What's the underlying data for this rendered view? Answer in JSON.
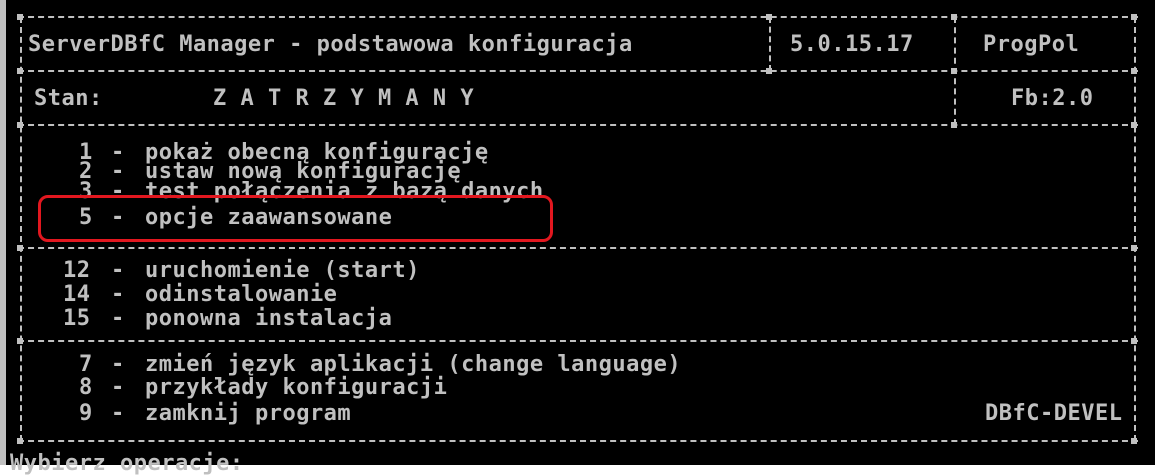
{
  "header": {
    "title": "ServerDBfC Manager - podstawowa konfiguracja",
    "version": "5.0.15.17",
    "vendor": "ProgPol"
  },
  "status": {
    "label": "Stan:",
    "value": "Z A T R Z Y M A N Y",
    "fb": "Fb:2.0"
  },
  "menu_group1": [
    {
      "number": "1",
      "label": "pokaż obecną konfigurację"
    },
    {
      "number": "2",
      "label": "ustaw nową konfigurację"
    },
    {
      "number": "3",
      "label": "test połączenia z bazą danych"
    },
    {
      "number": "5",
      "label": "opcje zaawansowane"
    }
  ],
  "menu_group2": [
    {
      "number": "12",
      "label": "uruchomienie (start)"
    },
    {
      "number": "14",
      "label": "odinstalowanie"
    },
    {
      "number": "15",
      "label": "ponowna instalacja"
    }
  ],
  "menu_group3": [
    {
      "number": "7",
      "label": "zmień język aplikacji (change language)"
    },
    {
      "number": "8",
      "label": "przykłady konfiguracji"
    },
    {
      "number": "9",
      "label": "zamknij program"
    }
  ],
  "footer_tag": "DBfC-DEVEL",
  "prompt": "Wybierz operacje:",
  "separator": "-",
  "colors": {
    "console_bg": "#000000",
    "console_fg": "#c0c0c0",
    "highlight": "#e2171f"
  }
}
